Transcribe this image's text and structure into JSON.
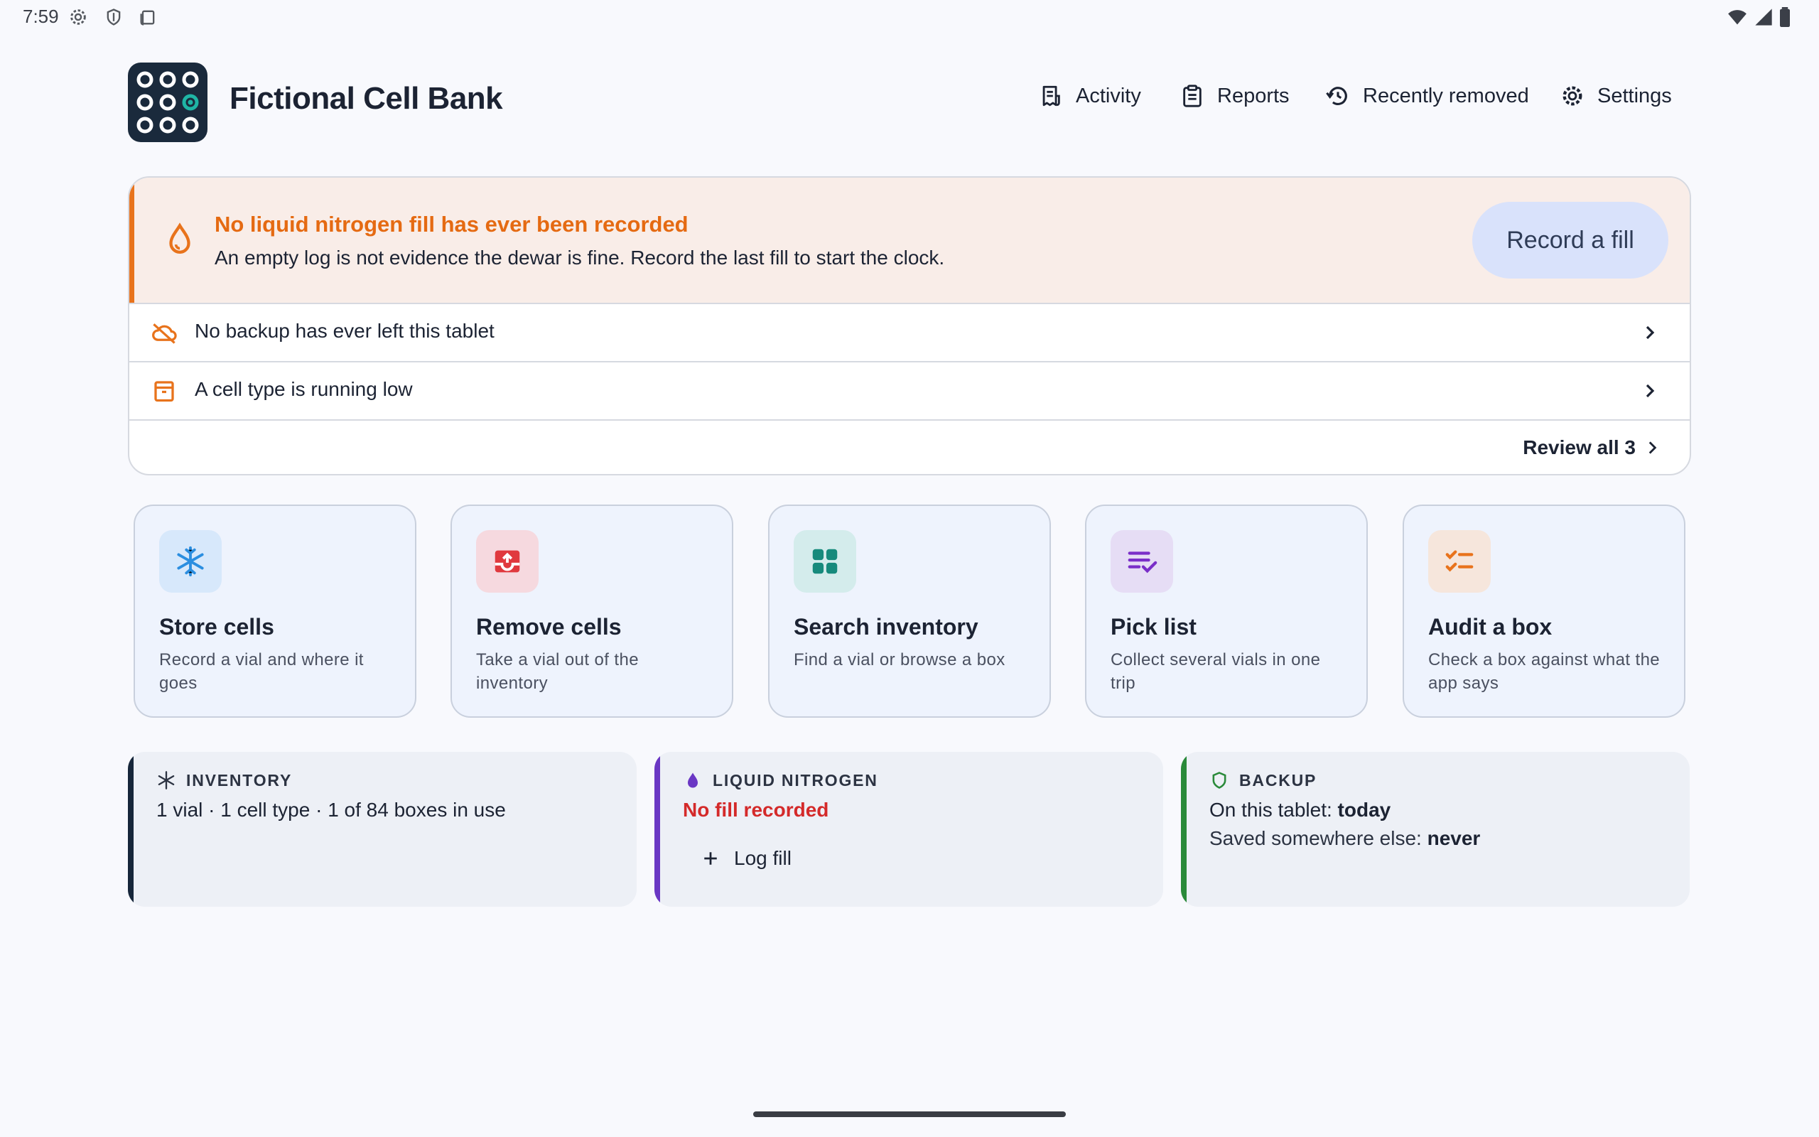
{
  "status_bar": {
    "time": "7:59"
  },
  "app": {
    "title": "Fictional Cell Bank"
  },
  "nav": {
    "activity": "Activity",
    "reports": "Reports",
    "recently_removed": "Recently removed",
    "settings": "Settings"
  },
  "alert": {
    "title": "No liquid nitrogen fill has ever been recorded",
    "body": "An empty log is not evidence the dewar is fine. Record the last fill to start the clock.",
    "button": "Record a fill",
    "rows": [
      {
        "label": "No backup has ever left this tablet",
        "icon": "cloud-off-icon"
      },
      {
        "label": "A cell type is running low",
        "icon": "archive-icon"
      }
    ],
    "review_all": "Review all 3"
  },
  "actions": [
    {
      "title": "Store cells",
      "desc": "Record a vial and where it goes",
      "icon": "snowflake-icon",
      "bg": "#d7e8fb",
      "fg": "#2b8ee0"
    },
    {
      "title": "Remove cells",
      "desc": "Take a vial out of the inventory",
      "icon": "tray-out-icon",
      "bg": "#f6d9df",
      "fg": "#e0393e"
    },
    {
      "title": "Search inventory",
      "desc": "Find a vial or browse a box",
      "icon": "grid-icon",
      "bg": "#d4ecec",
      "fg": "#168a7c"
    },
    {
      "title": "Pick list",
      "desc": "Collect several vials in one trip",
      "icon": "checklist-icon",
      "bg": "#e6ddf5",
      "fg": "#7a2ec8"
    },
    {
      "title": "Audit a box",
      "desc": "Check a box against what the app says",
      "icon": "audit-list-icon",
      "bg": "#f6e6dc",
      "fg": "#e8731c"
    }
  ],
  "tiles": {
    "inventory": {
      "heading": "INVENTORY",
      "line": "1 vial · 1 cell type · 1 of 84 boxes in use",
      "accent": "#16263a"
    },
    "nitrogen": {
      "heading": "LIQUID NITROGEN",
      "status": "No fill recorded",
      "action": "Log fill",
      "accent": "#6a37c4",
      "status_color": "#d42a2a"
    },
    "backup": {
      "heading": "BACKUP",
      "tablet_label": "On this tablet: ",
      "tablet_value": "today",
      "else_label": "Saved somewhere else: ",
      "else_value": "never",
      "accent": "#2a8a3a"
    }
  }
}
